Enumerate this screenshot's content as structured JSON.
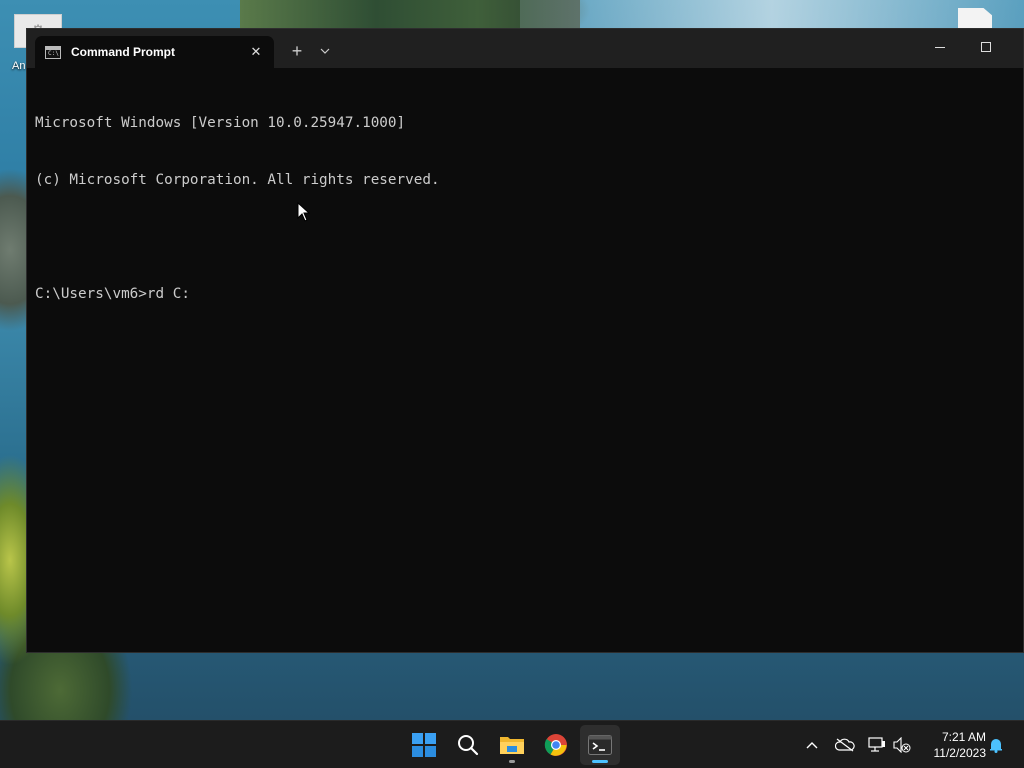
{
  "desktop": {
    "icon_left_label": "An"
  },
  "window": {
    "tab_title": "Command Prompt",
    "tab_close_glyph": "✕",
    "new_tab_glyph": "+",
    "dropdown_glyph": "⌄"
  },
  "console": {
    "lines": [
      "Microsoft Windows [Version 10.0.25947.1000]",
      "(c) Microsoft Corporation. All rights reserved.",
      "",
      "C:\\Users\\vm6>rd C:"
    ]
  },
  "taskbar": {
    "pinned": [
      "Start",
      "Search",
      "File Explorer",
      "Google Chrome",
      "Terminal"
    ],
    "active_app": "Terminal",
    "tray_chevron": "^"
  },
  "clock": {
    "time": "7:21 AM",
    "date": "11/2/2023"
  },
  "colors": {
    "terminal_bg": "#0c0c0c",
    "titlebar_bg": "#202020",
    "console_text": "#cccccc",
    "taskbar_bg": "#1c1c1c",
    "active_indicator": "#4cc2ff"
  },
  "icons": {
    "tab": "command-prompt-icon",
    "start": "windows-logo-icon",
    "search": "search-icon",
    "explorer": "folder-icon",
    "chrome": "chrome-icon",
    "terminal": "terminal-icon",
    "onedrive": "cloud-offline-icon",
    "network": "network-icon",
    "volume": "volume-muted-icon",
    "notifications": "bell-icon"
  }
}
